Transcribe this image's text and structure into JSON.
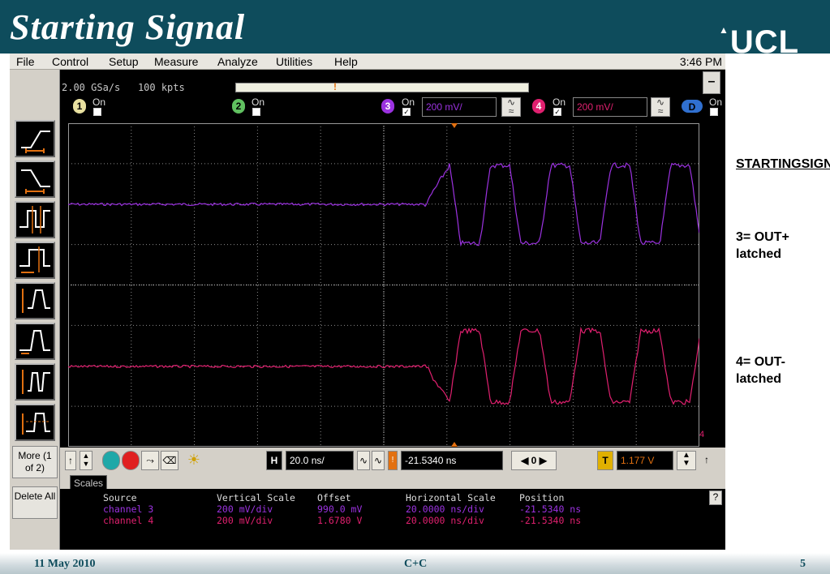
{
  "slide": {
    "title": "Starting Signal",
    "logo": "UCL",
    "footer": {
      "date": "11 May 2010",
      "center": "C+C",
      "page": "5"
    }
  },
  "notes": {
    "title": "STARTINGSIGNAL",
    "ch3": "3= OUT+ latched",
    "ch4": "4= OUT- latched"
  },
  "scope": {
    "menu": [
      "File",
      "Control",
      "Setup",
      "Measure",
      "Analyze",
      "Utilities",
      "Help"
    ],
    "clock": "3:46 PM",
    "acq": {
      "rate": "2.00 GSa/s",
      "points": "100 kpts"
    },
    "minimize_label": "–",
    "channels": [
      {
        "num": "1",
        "state": "On",
        "checked": false
      },
      {
        "num": "2",
        "state": "On",
        "checked": false
      },
      {
        "num": "3",
        "state": "On",
        "checked": true,
        "scale": "200 mV/"
      },
      {
        "num": "4",
        "state": "On",
        "checked": true,
        "scale": "200 mV/"
      },
      {
        "num": "D",
        "state": "On",
        "checked": false
      }
    ],
    "colors": {
      "ch3": "#9b32e0",
      "ch4": "#e0206f",
      "trigger": "#e27010"
    },
    "side_buttons": {
      "more": "More (1 of 2)",
      "delete": "Delete All"
    },
    "horizontal": {
      "label": "H",
      "scale": "20.0 ns/",
      "position": "-21.5340 ns",
      "ref": "0"
    },
    "trigger": {
      "label": "T",
      "level": "1.177 V",
      "marker": "4"
    },
    "scales_tab": "Scales",
    "scales_table": {
      "headers": [
        "Source",
        "Vertical Scale",
        "Offset",
        "Horizontal Scale",
        "Position"
      ],
      "rows": [
        [
          "channel 3",
          "200 mV/div",
          "990.0 mV",
          "20.0000 ns/div",
          "-21.5340 ns"
        ],
        [
          "channel 4",
          "200 mV/div",
          "1.6780 V",
          "20.0000 ns/div",
          "-21.5340 ns"
        ]
      ]
    },
    "help": "?"
  }
}
